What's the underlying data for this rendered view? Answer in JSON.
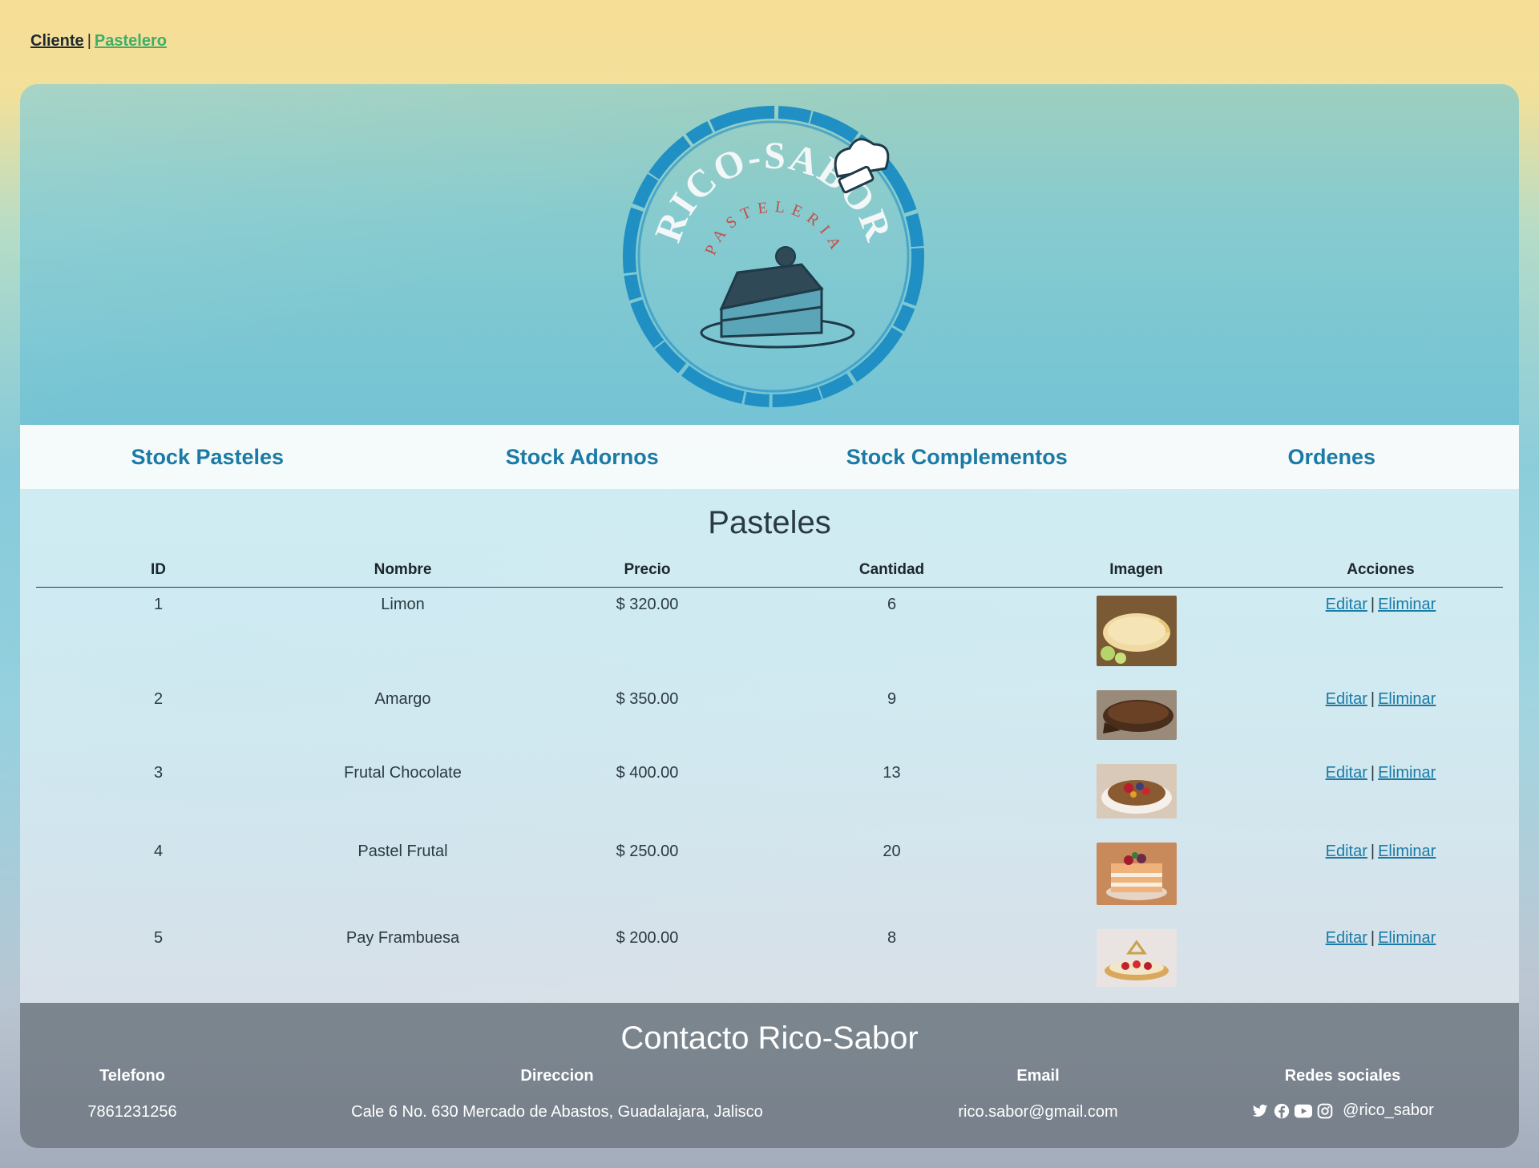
{
  "top_links": {
    "cliente": "Cliente",
    "separator": "|",
    "pastelero": "Pastelero"
  },
  "logo": {
    "brand": "RICO-SABOR",
    "subtitle": "PASTELERIA"
  },
  "nav": [
    "Stock Pasteles",
    "Stock Adornos",
    "Stock Complementos",
    "Ordenes"
  ],
  "section_title": "Pasteles",
  "table": {
    "headers": [
      "ID",
      "Nombre",
      "Precio",
      "Cantidad",
      "Imagen",
      "Acciones"
    ],
    "rows": [
      {
        "id": "1",
        "nombre": "Limon",
        "precio": "$ 320.00",
        "cantidad": "6",
        "image": "lemon-cake-photo"
      },
      {
        "id": "2",
        "nombre": "Amargo",
        "precio": "$ 350.00",
        "cantidad": "9",
        "image": "chocolate-cake-photo"
      },
      {
        "id": "3",
        "nombre": "Frutal Chocolate",
        "precio": "$ 400.00",
        "cantidad": "13",
        "image": "fruit-chocolate-cake-photo"
      },
      {
        "id": "4",
        "nombre": "Pastel Frutal",
        "precio": "$ 250.00",
        "cantidad": "20",
        "image": "fruit-cake-photo"
      },
      {
        "id": "5",
        "nombre": "Pay Frambuesa",
        "precio": "$ 200.00",
        "cantidad": "8",
        "image": "raspberry-pie-photo"
      }
    ],
    "edit_label": "Editar",
    "action_separator": "|",
    "delete_label": "Eliminar"
  },
  "footer": {
    "title": "Contacto Rico-Sabor",
    "telefono_label": "Telefono",
    "telefono": "7861231256",
    "direccion_label": "Direccion",
    "direccion": "Cale 6 No. 630 Mercado de Abastos, Guadalajara, Jalisco",
    "email_label": "Email",
    "email": "rico.sabor@gmail.com",
    "redes_label": "Redes sociales",
    "redes_handle": "@rico_sabor",
    "social_icons": [
      "twitter-icon",
      "facebook-icon",
      "youtube-icon",
      "instagram-icon"
    ]
  },
  "colors": {
    "nav_link": "#1a7ba6",
    "pastelero_link": "#3fae68",
    "footer_bg": "#767f89",
    "logo_ring": "#1f8fc4"
  }
}
